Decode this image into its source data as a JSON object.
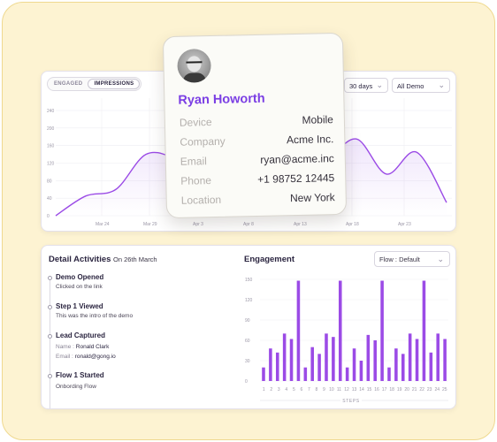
{
  "top": {
    "tabs": [
      "ENGAGED",
      "IMPRESSIONS"
    ],
    "active_tab": "IMPRESSIONS",
    "range_select": "30 days",
    "demo_select": "All Demo",
    "y_ticks": [
      "240",
      "200",
      "160",
      "120",
      "80",
      "40",
      "0"
    ],
    "x_ticks": [
      "Mar 24",
      "Mar 29",
      "Apr 3",
      "Apr 8",
      "Apr 13",
      "Apr 18",
      "Apr 23"
    ],
    "line_color": "#9b4be6"
  },
  "contact": {
    "name": "Ryan Howorth",
    "rows": [
      {
        "label": "Device",
        "value": "Mobile"
      },
      {
        "label": "Company",
        "value": "Acme Inc."
      },
      {
        "label": "Email",
        "value": "ryan@acme.inc"
      },
      {
        "label": "Phone",
        "value": "+1 98752 12445"
      },
      {
        "label": "Location",
        "value": "New York"
      }
    ],
    "name_color": "#7b3fe4"
  },
  "details": {
    "title": "Detail Activities",
    "date": "On 26th March",
    "events": [
      {
        "title": "Demo Opened",
        "sub": "Clicked on the link"
      },
      {
        "title": "Step 1 Viewed",
        "sub": "This was the intro of the demo"
      },
      {
        "title": "Lead Captured",
        "name_key": "Name :",
        "name_val": "Ronald Clark",
        "email_key": "Email :",
        "email_val": "ronald@gong.io"
      },
      {
        "title": "Flow 1 Started",
        "sub": "Onbording  Flow"
      }
    ]
  },
  "engagement": {
    "title": "Engagement",
    "flow_select": "Flow : Default",
    "xlabel": "STEPS",
    "bar_color": "#9b4be6"
  },
  "chart_data": [
    {
      "type": "area",
      "x": [
        "Mar 24",
        "Mar 29",
        "Apr 3",
        "Apr 8",
        "Apr 13",
        "Apr 18",
        "Apr 23"
      ],
      "y_ticks": [
        0,
        40,
        80,
        120,
        160,
        200,
        240
      ],
      "ylim": [
        0,
        240
      ],
      "series": [
        {
          "values": [
            0,
            45,
            60,
            140,
            130,
            95,
            30,
            20,
            55,
            120,
            175,
            95,
            145,
            30
          ]
        }
      ],
      "grid": true,
      "xlabel": "",
      "ylabel": ""
    },
    {
      "type": "bar",
      "categories": [
        "1",
        "2",
        "3",
        "4",
        "5",
        "6",
        "7",
        "8",
        "9",
        "10",
        "11",
        "12",
        "13",
        "14",
        "15",
        "16",
        "17",
        "18",
        "19",
        "20",
        "21",
        "22",
        "23",
        "24",
        "25"
      ],
      "values": [
        20,
        48,
        42,
        70,
        62,
        148,
        20,
        50,
        40,
        70,
        65,
        148,
        20,
        48,
        30,
        68,
        60,
        148,
        20,
        48,
        40,
        70,
        62,
        148,
        42,
        70,
        62
      ],
      "y_ticks": [
        0,
        30,
        60,
        90,
        120,
        150
      ],
      "ylim": [
        0,
        150
      ],
      "xlabel": "STEPS",
      "ylabel": ""
    }
  ]
}
